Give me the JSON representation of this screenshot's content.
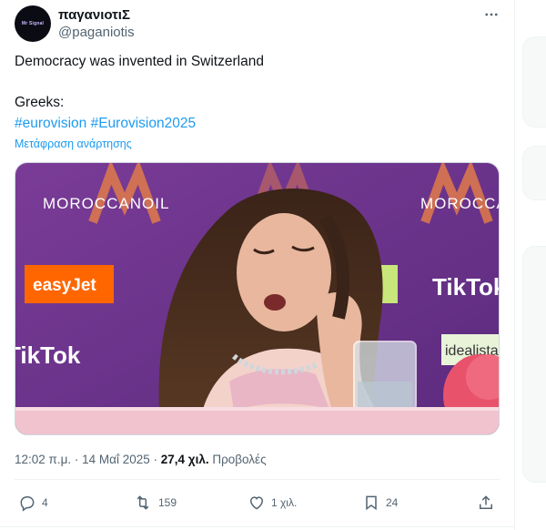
{
  "author": {
    "display_name": "παγανιοτιΣ",
    "handle": "@paganiotis",
    "avatar_text": "Mr Signal"
  },
  "tweet": {
    "line1": "Democracy was invented in Switzerland",
    "line2": "Greeks:",
    "hashtags": [
      "#eurovision",
      "#Eurovision2025"
    ],
    "translate_label": "Μετάφραση ανάρτησης"
  },
  "media": {
    "banners": {
      "brand": "MOROCCANOIL",
      "sponsor1": "easyJet",
      "sponsor2": "TikTok",
      "sponsor3": "idealista"
    }
  },
  "meta": {
    "time": "12:02 π.μ.",
    "separator": "·",
    "date": "14 Μαΐ 2025",
    "views_count": "27,4 χιλ.",
    "views_label": "Προβολές"
  },
  "actions": {
    "replies": "4",
    "reposts": "159",
    "likes": "1 χιλ.",
    "bookmarks": "24"
  },
  "colors": {
    "accent": "#1d9bf0",
    "secondary_text": "#536471",
    "banner_purple": "#6a2f8c",
    "easyjet_orange": "#ff6600"
  },
  "icons": {
    "more": "more-horizontal-icon",
    "reply": "reply-icon",
    "repost": "repost-icon",
    "like": "heart-icon",
    "bookmark": "bookmark-icon",
    "share": "share-icon"
  }
}
